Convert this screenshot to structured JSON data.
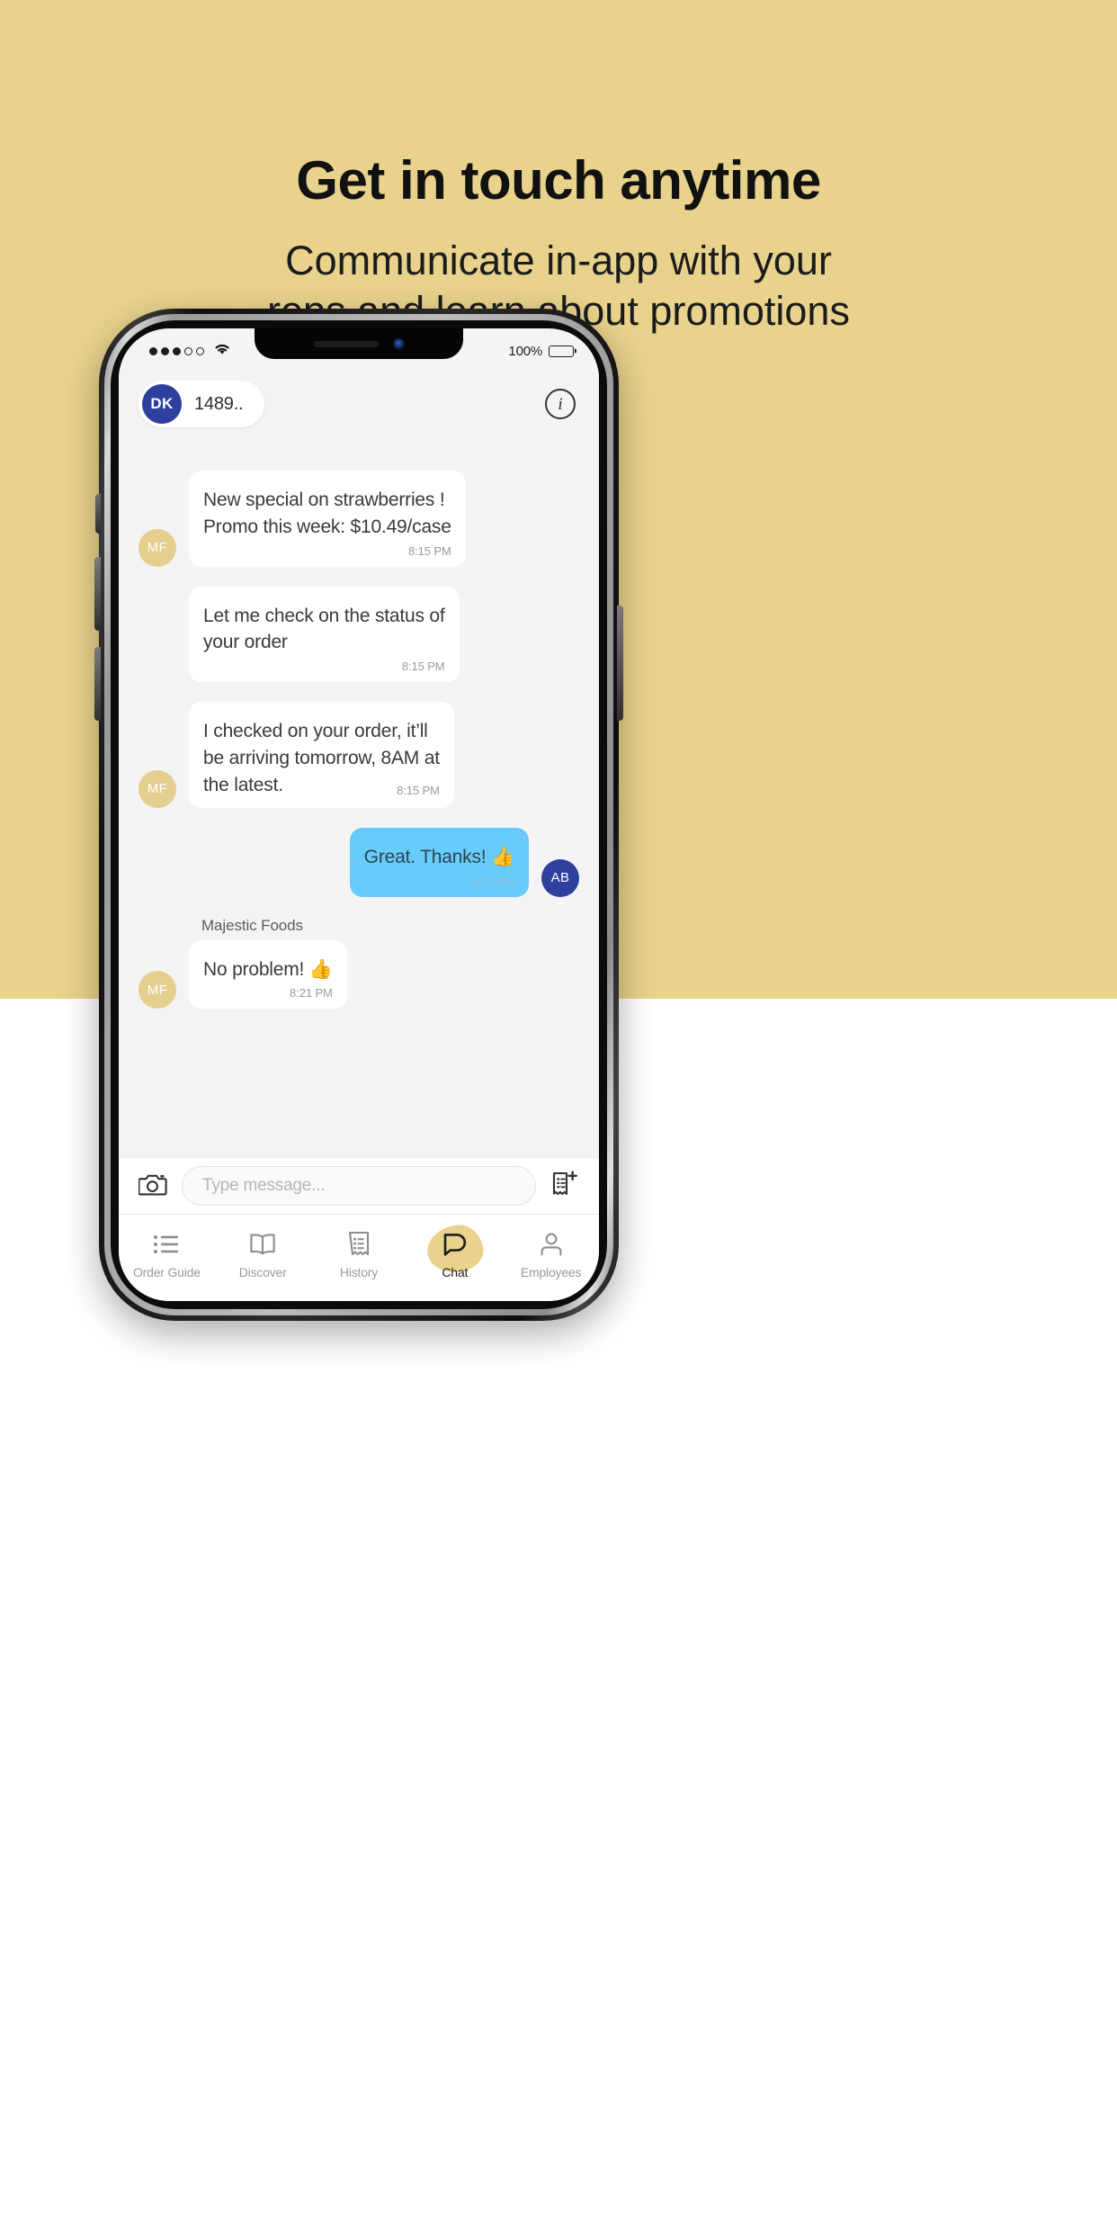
{
  "promo": {
    "title": "Get in touch anytime",
    "subtitle_line1": "Communicate in-app with your",
    "subtitle_line2": "reps and learn about promotions",
    "bg_color": "#e8d28c"
  },
  "status_bar": {
    "signal_filled": 3,
    "signal_empty": 2,
    "wifi": "wifi-icon",
    "battery_percent": "100%",
    "battery_level": 100
  },
  "header": {
    "avatar_initials": "DK",
    "avatar_color": "#2e3f9e",
    "title": "1489..",
    "info_label": "i"
  },
  "messages": [
    {
      "avatar": "MF",
      "avatar_color": "#e5cf8e",
      "side": "in",
      "show_avatar": true,
      "sender": "",
      "text": "New special on strawberries !\nPromo this week: $10.49/case",
      "time": "8:15 PM",
      "inline_time": false
    },
    {
      "avatar": "MF",
      "avatar_color": "#e5cf8e",
      "side": "in",
      "show_avatar": false,
      "sender": "",
      "text": "Let me check on the status of\nyour order",
      "time": "8:15 PM",
      "inline_time": false
    },
    {
      "avatar": "MF",
      "avatar_color": "#e5cf8e",
      "side": "in",
      "show_avatar": true,
      "sender": "",
      "text": "I checked on your order, it’ll\nbe arriving tomorrow, 8AM at\nthe latest.",
      "time": "8:15 PM",
      "inline_time": true
    },
    {
      "avatar": "AB",
      "avatar_color": "#2e3f9e",
      "side": "out",
      "show_avatar": true,
      "sender": "",
      "text": "Great. Thanks! 👍",
      "time": "8:20 PM",
      "inline_time": false
    },
    {
      "avatar": "MF",
      "avatar_color": "#e5cf8e",
      "side": "in",
      "show_avatar": true,
      "sender": "Majestic Foods",
      "text": "No problem! 👍",
      "time": "8:21 PM",
      "inline_time": false
    }
  ],
  "input_bar": {
    "camera_icon": "camera-icon",
    "placeholder": "Type message...",
    "value": "",
    "order_icon": "add-order-icon"
  },
  "tabs": [
    {
      "label": "Order Guide",
      "icon": "list-icon",
      "active": false
    },
    {
      "label": "Discover",
      "icon": "book-icon",
      "active": false
    },
    {
      "label": "History",
      "icon": "receipt-icon",
      "active": false
    },
    {
      "label": "Chat",
      "icon": "chat-bubble-icon",
      "active": true
    },
    {
      "label": "Employees",
      "icon": "person-icon",
      "active": false
    }
  ]
}
